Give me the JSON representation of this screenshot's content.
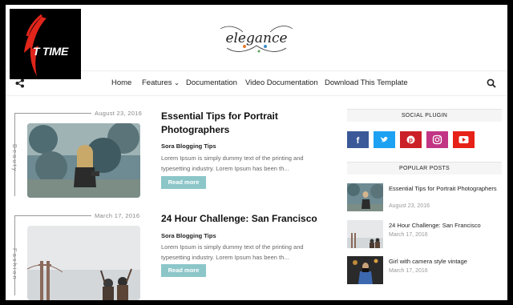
{
  "overlay_logo": {
    "text": "T TIME",
    "color": "#e1251b"
  },
  "site": {
    "logo_text": "elegance"
  },
  "nav": {
    "items": [
      "Home",
      "Features",
      "Documentation",
      "Video Documentation",
      "Download This Template"
    ],
    "features_caret": "⌄"
  },
  "posts": [
    {
      "date": "August 23, 2016",
      "category": "Beauty",
      "title": "Essential Tips for Portrait Photographers",
      "author": "Sora Blogging Tips",
      "excerpt": "Lorem Ipsum is simply dummy text of the printing and typesetting industry. Lorem Ipsum has been th...",
      "button": "Read more"
    },
    {
      "date": "March 17, 2016",
      "category": "Fashion",
      "title": "24 Hour Challenge: San Francisco",
      "author": "Sora Blogging Tips",
      "excerpt": "Lorem Ipsum is simply dummy text of the printing and typesetting industry. Lorem Ipsum has been th...",
      "button": "Read more"
    }
  ],
  "sidebar": {
    "social_title": "SOCIAL PLUGIN",
    "social": [
      {
        "name": "facebook",
        "color": "#3b5998"
      },
      {
        "name": "twitter",
        "color": "#1da1f2"
      },
      {
        "name": "pinterest",
        "color": "#cb2027"
      },
      {
        "name": "instagram",
        "color": "#c13584"
      },
      {
        "name": "youtube",
        "color": "#e62117"
      }
    ],
    "popular_title": "POPULAR POSTS",
    "popular": [
      {
        "title": "Essential Tips for Portrait Photographers",
        "date": "August 23, 2016"
      },
      {
        "title": "24 Hour Challenge: San Francisco",
        "date": "March 17, 2016"
      },
      {
        "title": "Girl with camera style vintage",
        "date": "March 17, 2016"
      }
    ]
  }
}
